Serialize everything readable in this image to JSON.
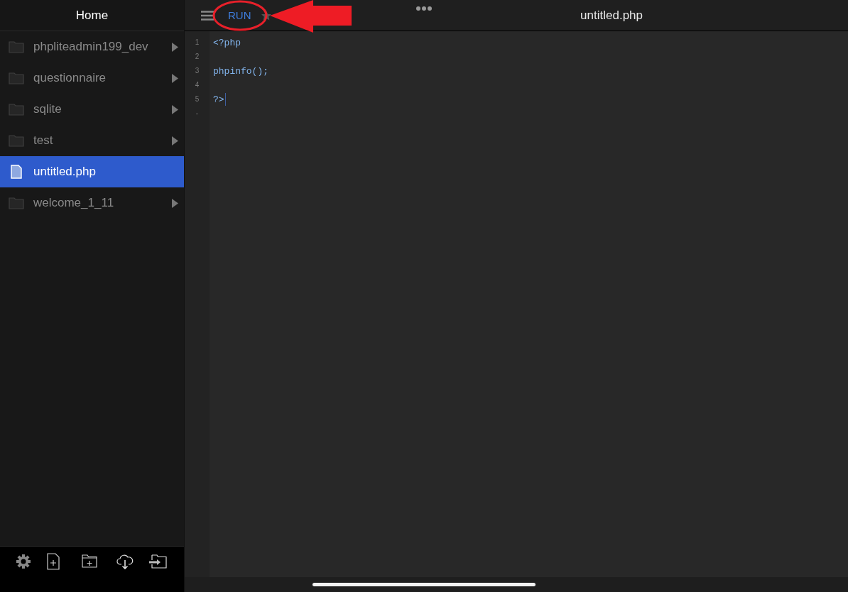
{
  "sidebar": {
    "title": "Home",
    "items": [
      {
        "kind": "folder",
        "name": "phpliteadmin199_dev",
        "selected": false
      },
      {
        "kind": "folder",
        "name": "questionnaire",
        "selected": false
      },
      {
        "kind": "folder",
        "name": "sqlite",
        "selected": false
      },
      {
        "kind": "folder",
        "name": "test",
        "selected": false
      },
      {
        "kind": "file",
        "name": "untitled.php",
        "selected": true
      },
      {
        "kind": "folder",
        "name": "welcome_1_11",
        "selected": false
      }
    ]
  },
  "editor": {
    "run_label": "RUN",
    "title": "untitled.php",
    "lines": [
      {
        "number": "1",
        "code": "<?php",
        "cursor": false
      },
      {
        "number": "2",
        "cursor": false
      },
      {
        "number": "3",
        "code": "phpinfo();",
        "cursor": false
      },
      {
        "number": "4",
        "cursor": false
      },
      {
        "number": "5",
        "code": "?>",
        "cursor": true
      }
    ],
    "gutter_end": "-"
  }
}
